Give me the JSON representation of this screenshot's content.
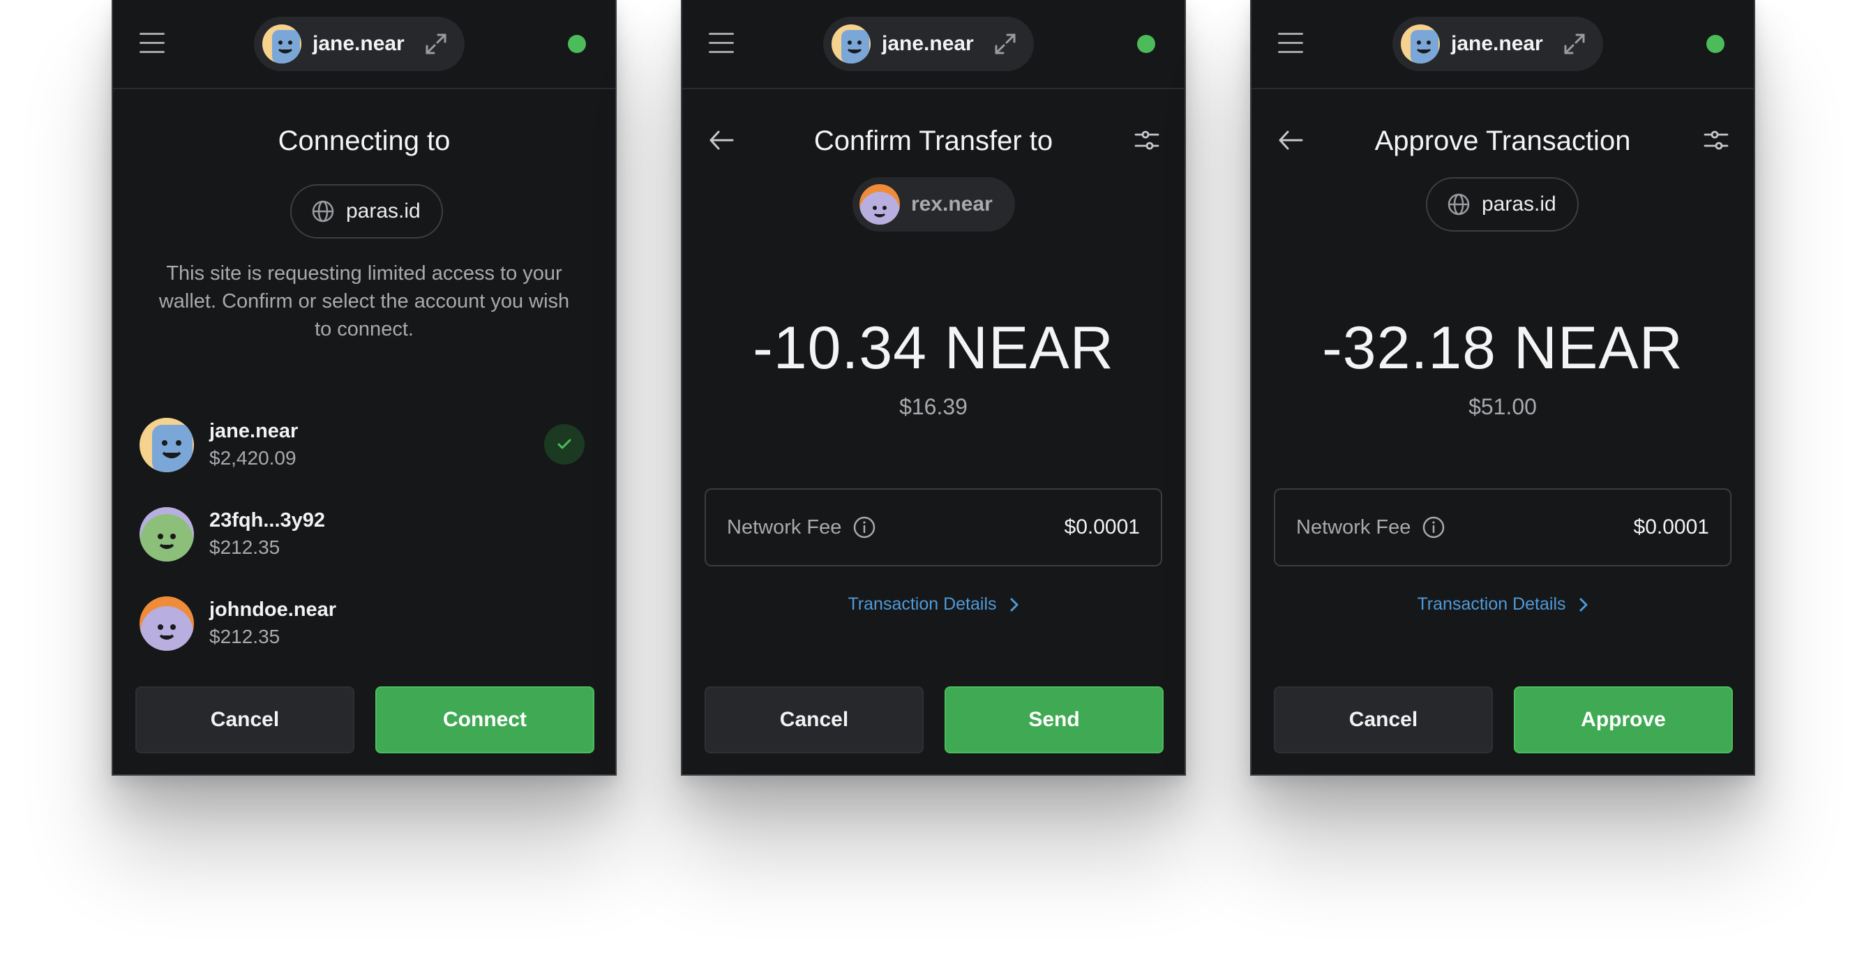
{
  "colors": {
    "background": "#161719",
    "accent_green": "#3faa53",
    "link_blue": "#4f9ad9",
    "online": "#4cbb5a"
  },
  "header": {
    "account_name": "jane.near"
  },
  "screen_connect": {
    "title": "Connecting to",
    "site": "paras.id",
    "description": "This site is requesting limited access to your wallet. Confirm or select the account you wish to connect.",
    "accounts": [
      {
        "name": "jane.near",
        "balance": "$2,420.09",
        "selected": true
      },
      {
        "name": "23fqh...3y92",
        "balance": "$212.35",
        "selected": false
      },
      {
        "name": "johndoe.near",
        "balance": "$212.35",
        "selected": false
      }
    ],
    "cancel_label": "Cancel",
    "confirm_label": "Connect"
  },
  "screen_transfer": {
    "title": "Confirm Transfer to",
    "recipient": "rex.near",
    "amount": "-10.34 NEAR",
    "fiat": "$16.39",
    "fee_label": "Network Fee",
    "fee_value": "$0.0001",
    "details_link": "Transaction Details",
    "cancel_label": "Cancel",
    "confirm_label": "Send"
  },
  "screen_approve": {
    "title": "Approve Transaction",
    "site": "paras.id",
    "amount": "-32.18 NEAR",
    "fiat": "$51.00",
    "fee_label": "Network Fee",
    "fee_value": "$0.0001",
    "details_link": "Transaction Details",
    "cancel_label": "Cancel",
    "confirm_label": "Approve"
  }
}
